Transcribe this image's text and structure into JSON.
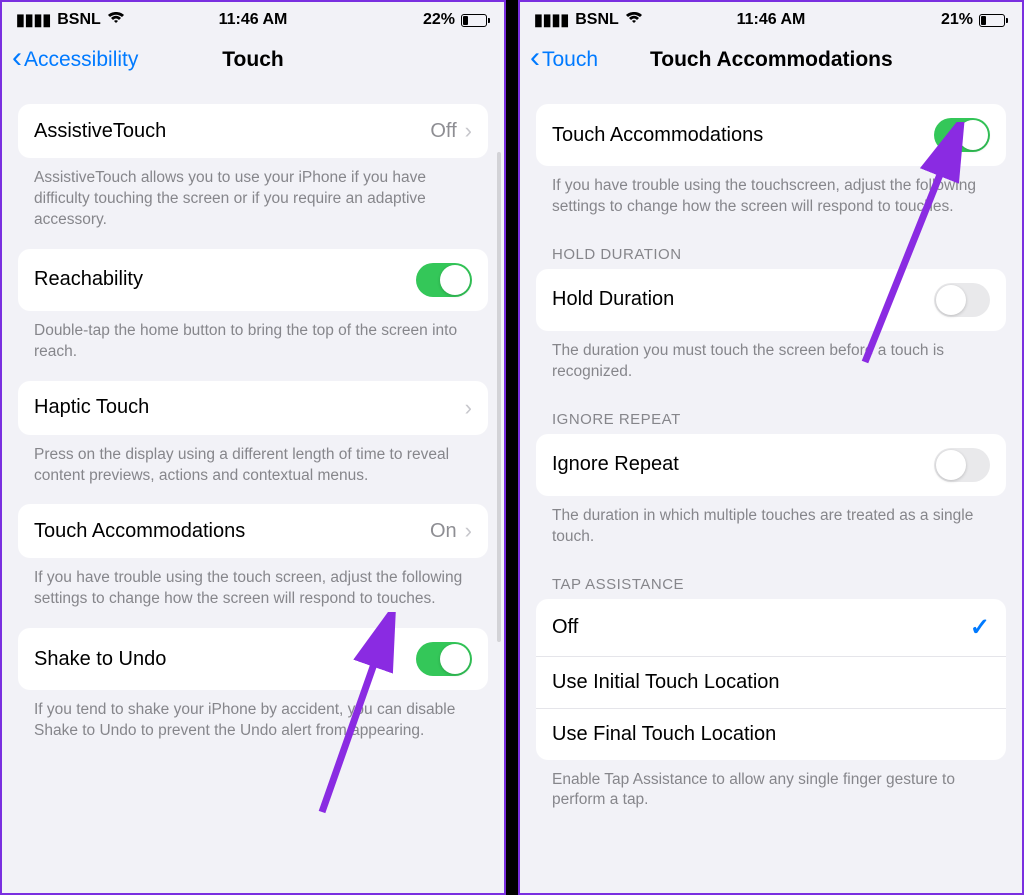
{
  "left": {
    "status": {
      "carrier": "BSNL",
      "time": "11:46 AM",
      "battery": "22%"
    },
    "nav": {
      "back": "Accessibility",
      "title": "Touch"
    },
    "rows": {
      "assistive": {
        "label": "AssistiveTouch",
        "value": "Off"
      },
      "assistive_desc": "AssistiveTouch allows you to use your iPhone if you have difficulty touching the screen or if you require an adaptive accessory.",
      "reachability": {
        "label": "Reachability"
      },
      "reachability_desc": "Double-tap the home button to bring the top of the screen into reach.",
      "haptic": {
        "label": "Haptic Touch"
      },
      "haptic_desc": "Press on the display using a different length of time to reveal content previews, actions and contextual menus.",
      "accom": {
        "label": "Touch Accommodations",
        "value": "On"
      },
      "accom_desc": "If you have trouble using the touch screen, adjust the following settings to change how the screen will respond to touches.",
      "shake": {
        "label": "Shake to Undo"
      },
      "shake_desc": "If you tend to shake your iPhone by accident, you can disable Shake to Undo to prevent the Undo alert from appearing."
    }
  },
  "right": {
    "status": {
      "carrier": "BSNL",
      "time": "11:46 AM",
      "battery": "21%"
    },
    "nav": {
      "back": "Touch",
      "title": "Touch Accommodations"
    },
    "rows": {
      "main": {
        "label": "Touch Accommodations"
      },
      "main_desc": "If you have trouble using the touchscreen, adjust the following settings to change how the screen will respond to touches.",
      "hold_hdr": "HOLD DURATION",
      "hold": {
        "label": "Hold Duration"
      },
      "hold_desc": "The duration you must touch the screen before a touch is recognized.",
      "ignore_hdr": "IGNORE REPEAT",
      "ignore": {
        "label": "Ignore Repeat"
      },
      "ignore_desc": "The duration in which multiple touches are treated as a single touch.",
      "tap_hdr": "TAP ASSISTANCE",
      "tap_off": "Off",
      "tap_initial": "Use Initial Touch Location",
      "tap_final": "Use Final Touch Location",
      "tap_desc": "Enable Tap Assistance to allow any single finger gesture to perform a tap."
    }
  },
  "arrow_color": "#8a2be2"
}
